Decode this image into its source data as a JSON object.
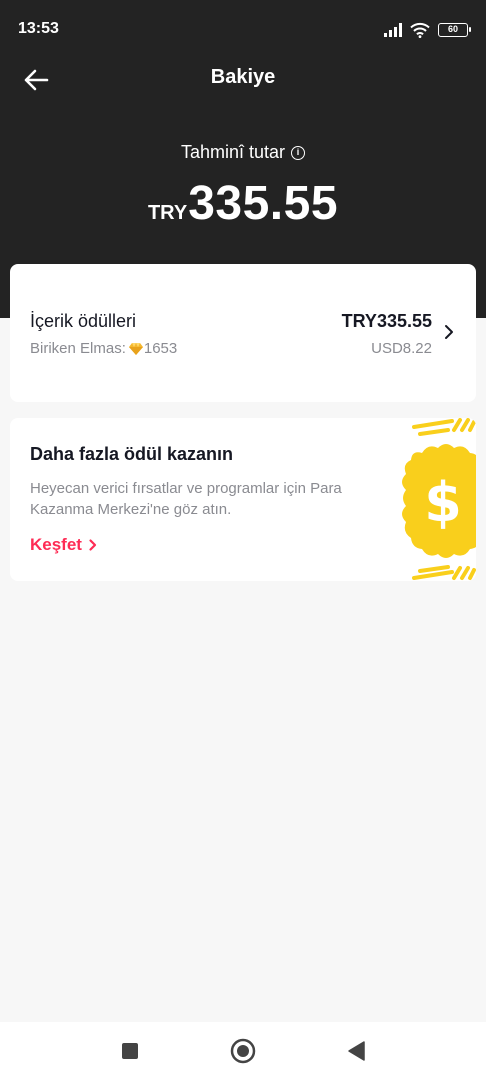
{
  "status_bar": {
    "time": "13:53",
    "battery": "60"
  },
  "header": {
    "title": "Bakiye"
  },
  "balance": {
    "label": "Tahminî tutar",
    "currency": "TRY",
    "amount": "335.55"
  },
  "rewards": {
    "title": "İçerik ödülleri",
    "diamonds_label": "Biriken Elmas:",
    "diamonds_count": "1653",
    "amount_try": "TRY335.55",
    "amount_usd": "USD8.22"
  },
  "promo": {
    "title": "Daha fazla ödül kazanın",
    "description": "Heyecan verici fırsatlar ve programlar için Para Kazanma Merkezi'ne göz atın.",
    "link": "Keşfet"
  },
  "colors": {
    "header_bg": "#232323",
    "accent": "#fe2c55",
    "coin": "#f9cf1c"
  },
  "icons": [
    "back-arrow-icon",
    "info-icon",
    "diamond-icon",
    "chevron-right-icon",
    "dollar-coin-icon",
    "stop-square-icon",
    "home-circle-icon",
    "back-triangle-icon"
  ]
}
